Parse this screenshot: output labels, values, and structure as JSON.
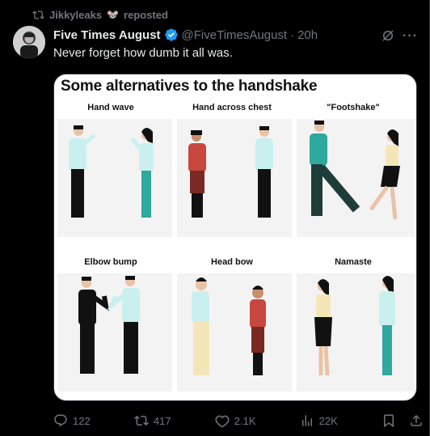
{
  "repost": {
    "user": "Jikkyleaks",
    "emoji": "🐭",
    "label": "reposted"
  },
  "tweet": {
    "display_name": "Five Times August",
    "handle": "@FiveTimesAugust",
    "separator": "·",
    "time": "20h",
    "text": "Never forget how dumb it all was."
  },
  "media": {
    "title": "Some alternatives to the handshake",
    "labels": [
      "Hand wave",
      "Hand across chest",
      "\"Footshake\"",
      "Elbow bump",
      "Head bow",
      "Namaste"
    ]
  },
  "actions": {
    "replies": "122",
    "reposts": "417",
    "likes": "2.1K",
    "views": "22K"
  },
  "colors": {
    "verified": "#1d9bf0",
    "muted": "#71767b",
    "text": "#e7e9ea"
  },
  "icons": [
    "repost-icon",
    "verified-badge-icon",
    "grok-icon",
    "more-icon",
    "reply-icon",
    "like-icon",
    "views-icon",
    "bookmark-icon",
    "share-icon"
  ]
}
